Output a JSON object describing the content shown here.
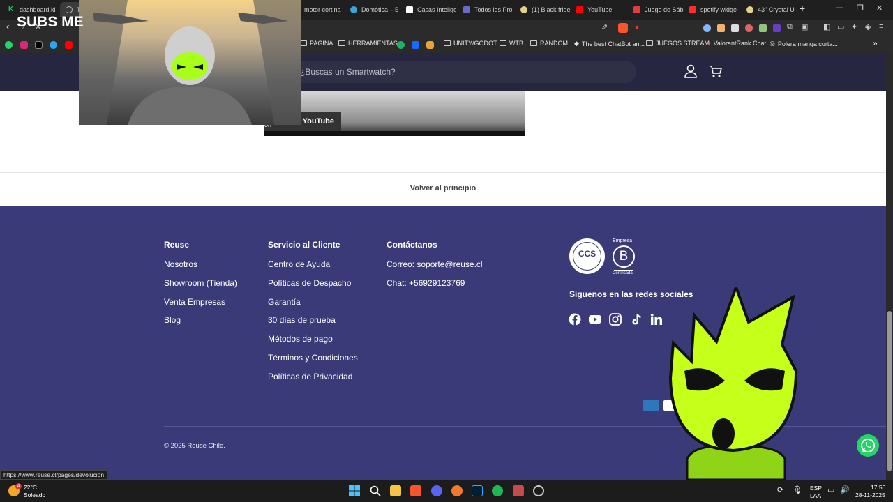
{
  "browser": {
    "tabs": [
      {
        "label": "dashboard.ki",
        "color": "#25c26e"
      },
      {
        "label": "T",
        "color": "#bbbbbb"
      },
      {
        "label": "motor cortina",
        "color": "#888888"
      },
      {
        "label": "Domótica – B",
        "color": "#3aa3d8"
      },
      {
        "label": "Casas Intelige",
        "color": "#ffffff"
      },
      {
        "label": "Todos los Pro",
        "color": "#6a6acb"
      },
      {
        "label": "(1) Black fride",
        "color": "#e5d08a"
      },
      {
        "label": "YouTube",
        "color": "#ff0000"
      },
      {
        "label": "Juego de Sáb",
        "color": "#e23b3b"
      },
      {
        "label": "spotify widge",
        "color": "#ff2d2d"
      },
      {
        "label": "43\" Crystal U",
        "color": "#e5d08a"
      }
    ],
    "new_tab": "+",
    "window_controls": [
      "—",
      "❐",
      "✕"
    ],
    "bookmarks": [
      {
        "label": "PAGINA"
      },
      {
        "label": "HERRAMIENTAS"
      },
      {
        "label": "UNITY/GODOT"
      },
      {
        "label": "WTB"
      },
      {
        "label": "RANDOM"
      },
      {
        "label": "The best ChatBot an..."
      },
      {
        "label": "JUEGOS STREAM"
      },
      {
        "label": "ValorantRank.Chat"
      },
      {
        "label": "Polera manga corta..."
      }
    ],
    "bookmarks_more": "»"
  },
  "stream_overlay": {
    "title": "SUBS ME"
  },
  "site": {
    "search_placeholder": "¿Buscas un Smartwatch?",
    "video_watch_on": "Watch on",
    "video_brand": "YouTube",
    "back_to_top": "Volver al principio",
    "footer": {
      "col_reuse": {
        "title": "Reuse",
        "links": [
          "Nosotros",
          "Showroom (Tienda)",
          "Venta Empresas",
          "Blog"
        ]
      },
      "col_service": {
        "title": "Servicio al Cliente",
        "links": [
          "Centro de Ayuda",
          "Políticas de Despacho",
          "Garantía",
          "30 días de prueba",
          "Métodos de pago",
          "Términos y Condiciones",
          "Políticas de Privacidad"
        ]
      },
      "col_contact": {
        "title": "Contáctanos",
        "email_label": "Correo: ",
        "email": "soporte@reuse.cl",
        "chat_label": "Chat: ",
        "chat": "+56929123769"
      },
      "badges": {
        "ccs": "CCS",
        "bcorp_top": "Empresa",
        "bcorp_letter": "B",
        "bcorp_bottom": "Certificada"
      },
      "social_title": "Síguenos en las redes sociales",
      "social_icons": [
        "facebook-icon",
        "youtube-icon",
        "instagram-icon",
        "tiktok-icon",
        "linkedin-icon"
      ],
      "copyright": "© 2025 Reuse Chile."
    }
  },
  "status_url": "https://www.reuse.cl/pages/devolucion",
  "taskbar": {
    "weather_temp": "22°C",
    "weather_desc": "Soleado",
    "weather_badge": "4",
    "lang_top": "ESP",
    "lang_bottom": "LAA",
    "time": "17:56",
    "date": "28-11-2025"
  }
}
